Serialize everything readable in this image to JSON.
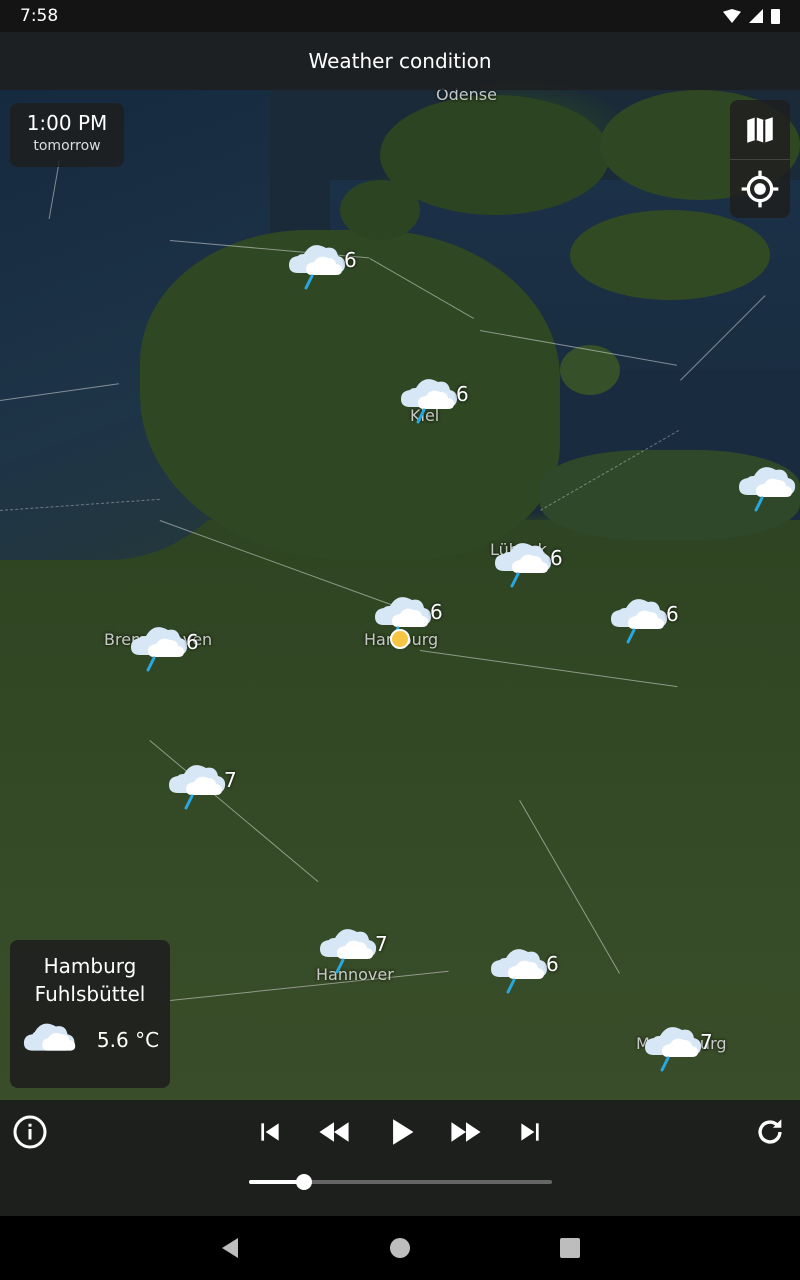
{
  "status_bar": {
    "time": "7:58"
  },
  "header": {
    "title": "Weather condition"
  },
  "time_box": {
    "time": "1:00 PM",
    "day": "tomorrow"
  },
  "places": [
    {
      "name": "Odense"
    },
    {
      "name": "Kiel"
    },
    {
      "name": "Lübeck"
    },
    {
      "name": "Bremerhaven"
    },
    {
      "name": "Hamburg"
    },
    {
      "name": "Hannover"
    },
    {
      "name": "Magdeburg"
    }
  ],
  "markers": [
    {
      "value": "6"
    },
    {
      "value": "6"
    },
    {
      "value": ""
    },
    {
      "value": "6"
    },
    {
      "value": "6"
    },
    {
      "value": "6"
    },
    {
      "value": "6"
    },
    {
      "value": "7"
    },
    {
      "value": "7"
    },
    {
      "value": "6"
    },
    {
      "value": "7"
    }
  ],
  "station": {
    "name_line1": "Hamburg",
    "name_line2": "Fuhlsbüttel",
    "temperature": "5.6 °C"
  },
  "player": {
    "progress": 0.18
  },
  "colors": {
    "panel": "#1e1e1e",
    "sun": "#f6c543",
    "rain": "#29a8e0",
    "cloud": "#e9f2fb"
  }
}
